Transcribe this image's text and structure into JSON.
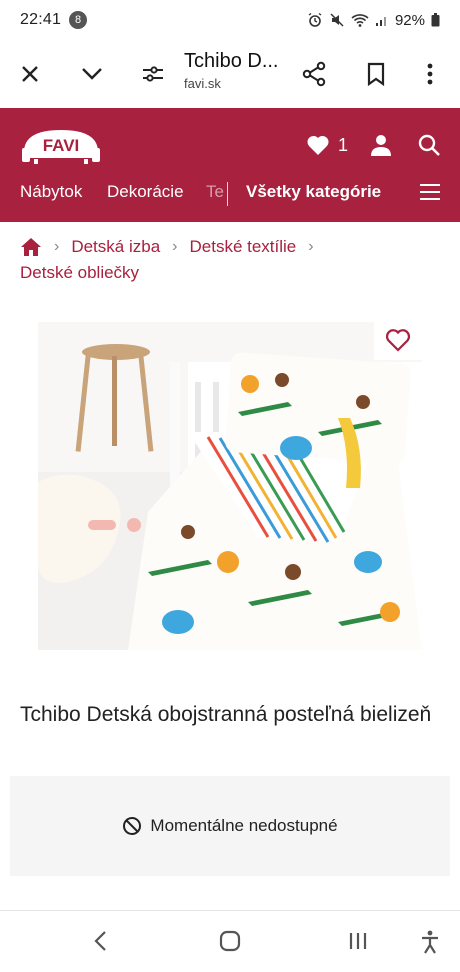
{
  "status_bar": {
    "time": "22:41",
    "notification_count": "8",
    "battery": "92%"
  },
  "browser": {
    "page_title": "Tchibo D...",
    "url": "favi.sk"
  },
  "header": {
    "logo_text": "FAVI",
    "wishlist_count": "1",
    "nav": {
      "item1": "Nábytok",
      "item2": "Dekorácie",
      "item3_partial": "Te",
      "all_categories": "Všetky kategórie"
    }
  },
  "breadcrumb": {
    "level1": "Detská izba",
    "level2": "Detské textílie",
    "level3": "Detské obliečky"
  },
  "product": {
    "title": "Tchibo Detská obojstranná posteľná bielizeň",
    "availability": "Momentálne nedostupné"
  },
  "colors": {
    "brand": "#a8213e",
    "availability_bg": "#f5f5f5"
  }
}
